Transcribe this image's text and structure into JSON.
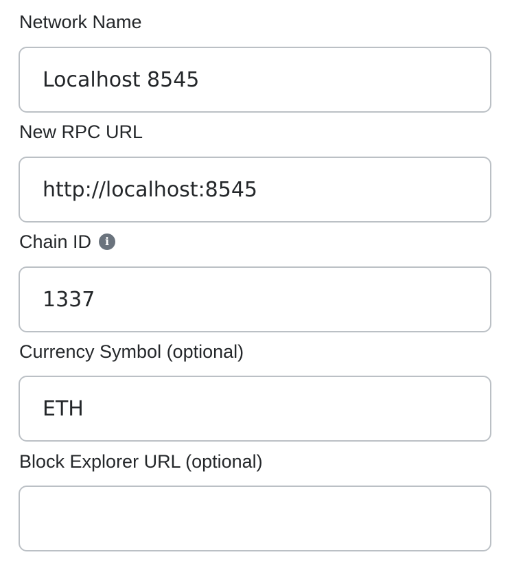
{
  "form": {
    "network_name": {
      "label": "Network Name",
      "value": "Localhost 8545"
    },
    "rpc_url": {
      "label": "New RPC URL",
      "value": "http://localhost:8545"
    },
    "chain_id": {
      "label": "Chain ID",
      "value": "1337",
      "info_icon": "info-icon",
      "info_glyph": "i"
    },
    "currency_symbol": {
      "label": "Currency Symbol (optional)",
      "value": "ETH"
    },
    "block_explorer": {
      "label": "Block Explorer URL (optional)",
      "value": ""
    }
  },
  "colors": {
    "text": "#24272a",
    "border": "#bbc0c5",
    "info_icon": "#6a737d"
  }
}
